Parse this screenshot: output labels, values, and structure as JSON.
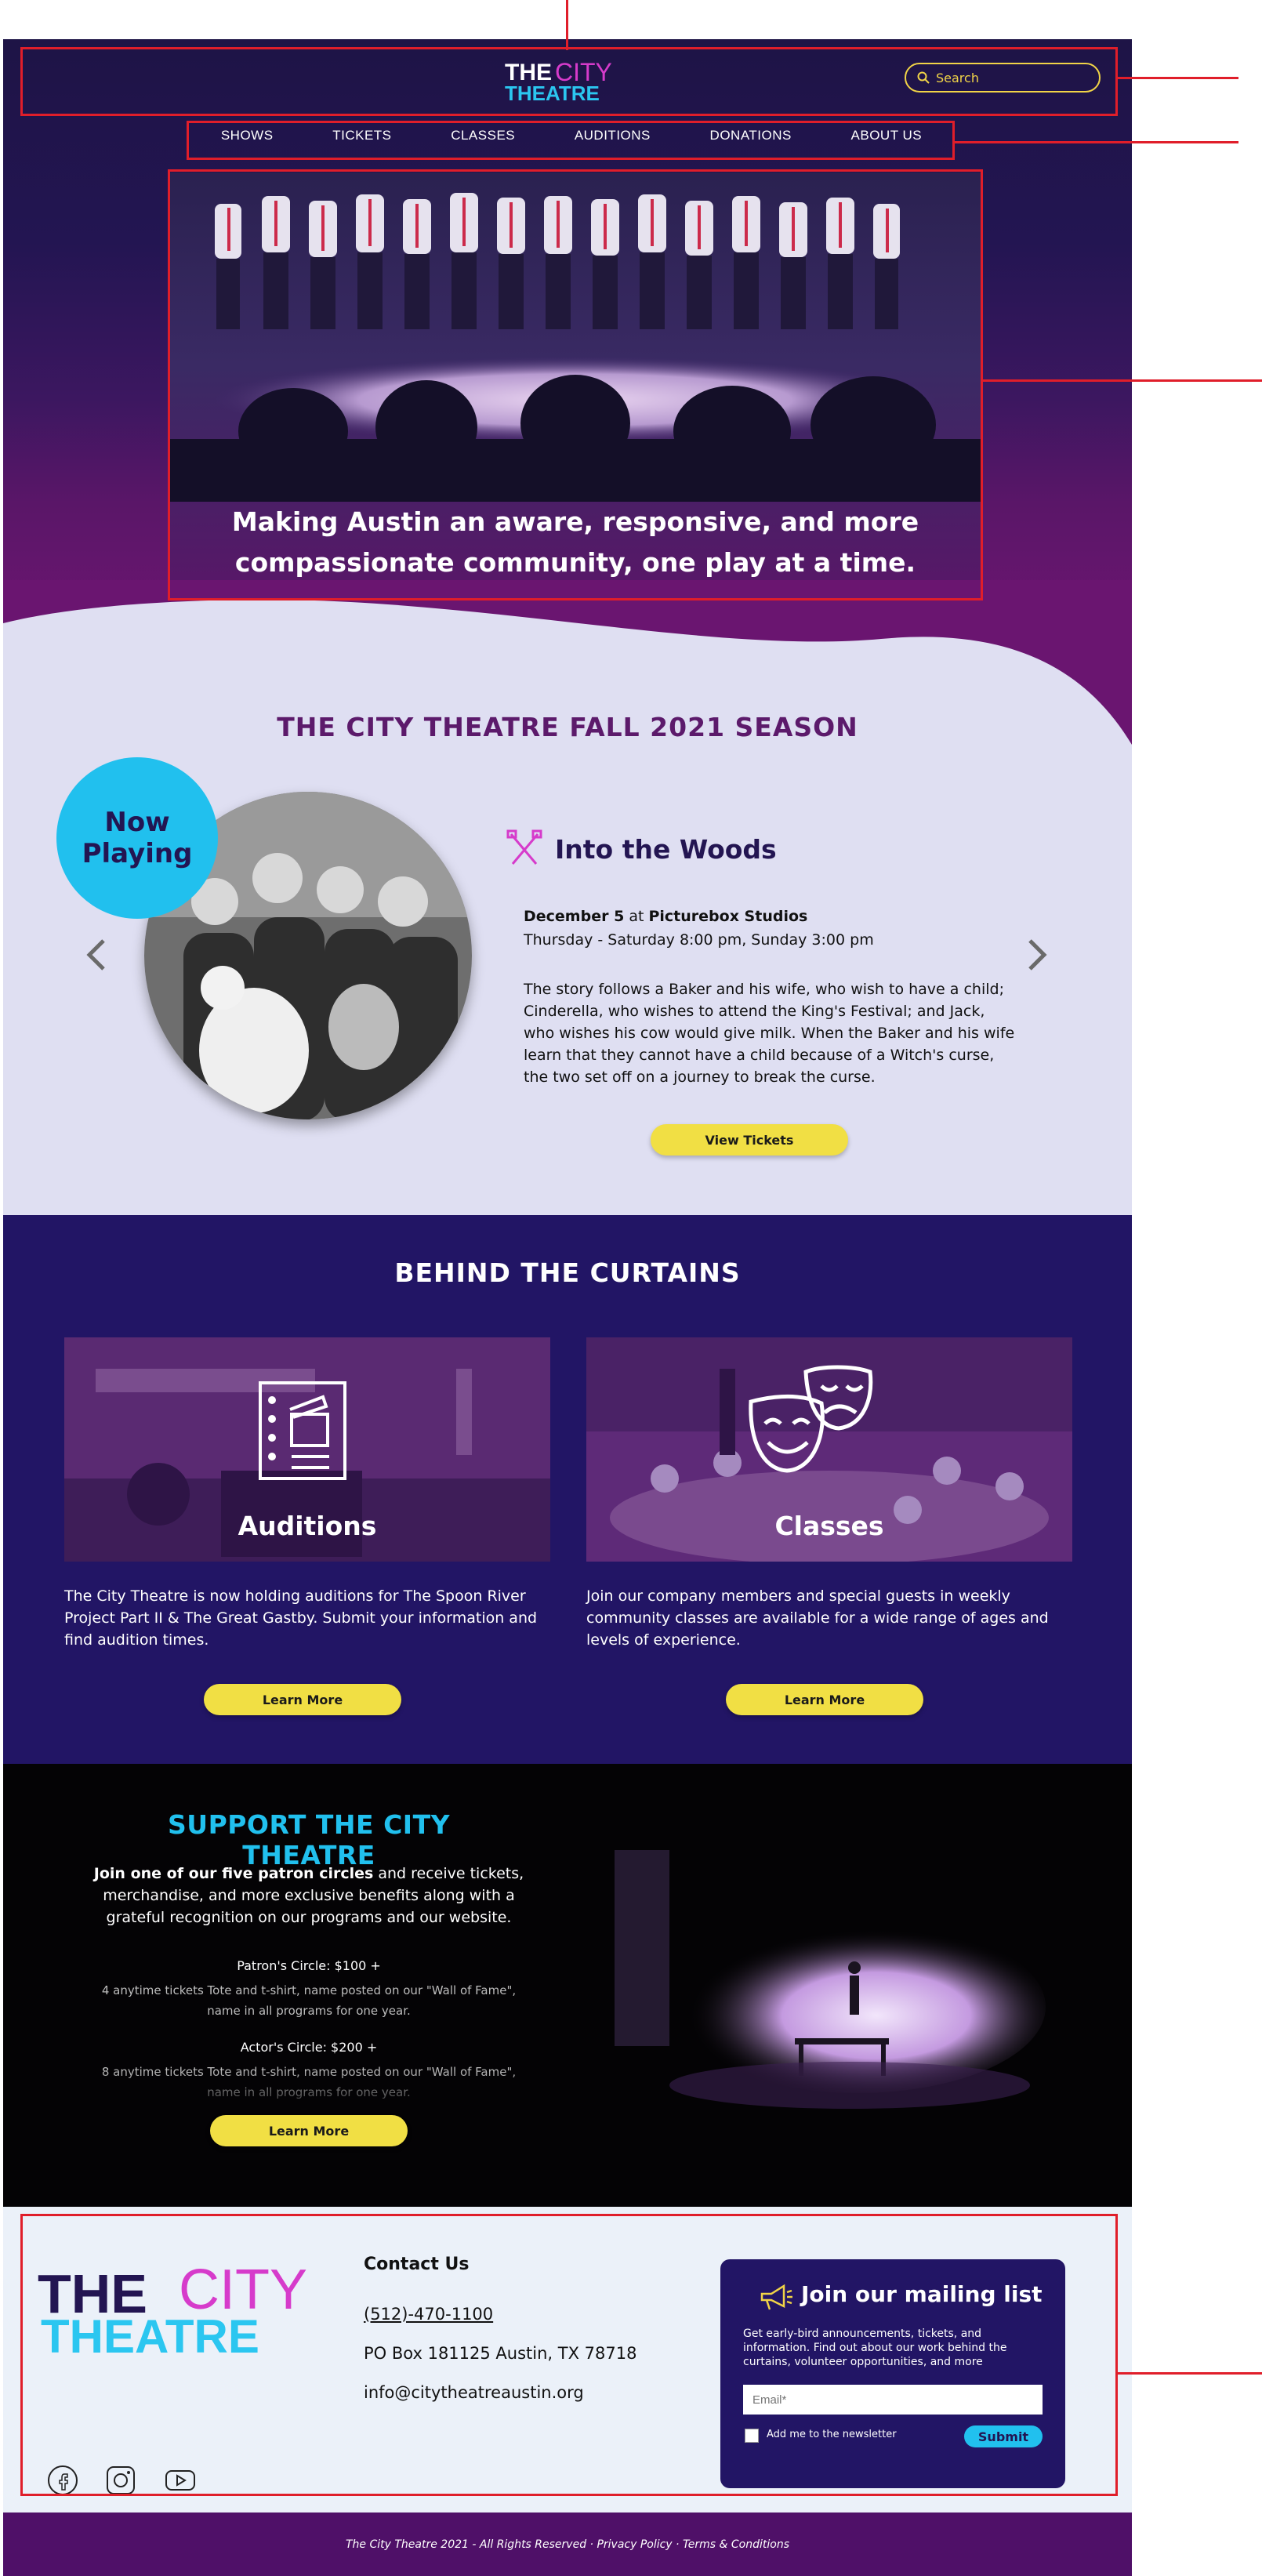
{
  "header": {
    "logo": {
      "the": "THE",
      "city": "CITY",
      "theatre": "THEATRE"
    },
    "search_placeholder": "Search"
  },
  "nav": {
    "items": [
      "SHOWS",
      "TICKETS",
      "CLASSES",
      "AUDITIONS",
      "DONATIONS",
      "ABOUT US"
    ]
  },
  "hero": {
    "line1": "Making Austin an aware, responsive, and more",
    "line2": "compassionate community, one play at a time."
  },
  "season": {
    "title": "THE CITY THEATRE FALL 2021 SEASON",
    "badge_line1": "Now",
    "badge_line2": "Playing",
    "show_title": "Into the Woods",
    "date_bold": "December 5",
    "date_at": " at ",
    "venue": "Picturebox Studios",
    "times": "Thursday - Saturday 8:00 pm, Sunday 3:00 pm",
    "description": "The story follows a Baker and his wife, who wish to have a child; Cinderella, who wishes to attend the King's Festival; and Jack, who wishes his cow would give milk. When the Baker and his wife learn that they cannot have a child because of a Witch's curse, the two set off on a journey to break the curse.",
    "cta": "View Tickets"
  },
  "behind": {
    "title": "BEHIND THE CURTAINS",
    "cards": [
      {
        "label": "Auditions",
        "text": "The City Theatre is now holding auditions for The Spoon River Project Part II & The Great Gastby. Submit your information and find audition times.",
        "cta": "Learn More"
      },
      {
        "label": "Classes",
        "text": "Join our company members and special guests in weekly community classes are available for a wide range of ages and levels of experience.",
        "cta": "Learn More"
      }
    ]
  },
  "support": {
    "title": "SUPPORT THE CITY THEATRE",
    "lead_bold": "Join one of our five patron circles",
    "lead_rest": " and receive tickets, merchandise, and more exclusive benefits along with a grateful recognition on our programs and our website.",
    "tiers": [
      {
        "name": "Patron's Circle: $100 +",
        "desc": "4 anytime tickets Tote and t-shirt, name posted on our \"Wall of Fame\", name in all programs for one year."
      },
      {
        "name": "Actor's Circle: $200 +",
        "desc": "8 anytime tickets Tote and t-shirt, name posted on our \"Wall of Fame\", name in all programs for one year."
      }
    ],
    "cta": "Learn More"
  },
  "footer": {
    "contact_heading": "Contact Us",
    "phone": "(512)-470-1100",
    "address": "PO Box 181125 Austin, TX 78718",
    "email": "info@citytheatreaustin.org",
    "mailing_title": "Join our mailing list",
    "mailing_desc": "Get early-bird announcements, tickets, and information. Find out about our work behind the curtains, volunteer opportunities, and more",
    "email_placeholder": "Email*",
    "newsletter_label": "Add me to the newsletter",
    "submit": "Submit",
    "bottom_text": "The City Theatre 2021 - All Rights Reserved · Privacy Policy · Terms & Conditions"
  },
  "colors": {
    "accent_yellow": "#f1df44",
    "accent_cyan": "#21c0ee",
    "accent_magenta": "#d63bcb",
    "navy": "#221565",
    "annotation_red": "#e01e2a"
  }
}
